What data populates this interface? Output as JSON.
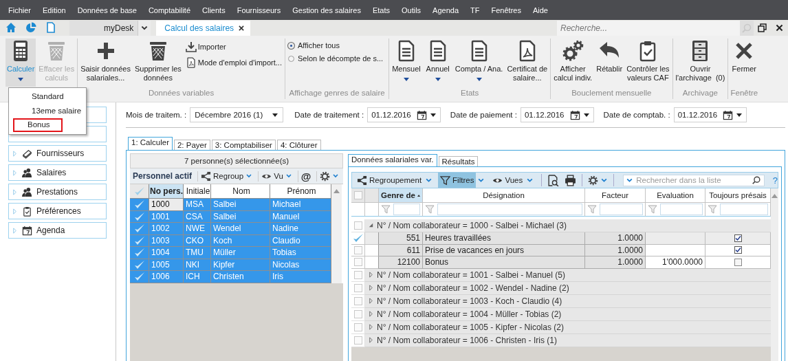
{
  "menu_bar": [
    "Fichier",
    "Edition",
    "Données de base",
    "Comptabilité",
    "Clients",
    "Fournisseurs",
    "Gestion des salaires",
    "Etats",
    "Outils",
    "Agenda",
    "TF",
    "Fenêtres",
    "Aide"
  ],
  "doc_tabs": [
    {
      "label": "myDesk",
      "kind": "dropdown",
      "selected": false
    },
    {
      "label": "Calcul des salaires",
      "kind": "closable",
      "selected": true
    }
  ],
  "search": {
    "placeholder": "Recherche..."
  },
  "ribbon": {
    "groups": [
      {
        "buttons": [
          {
            "label": "Calculer",
            "selected": true,
            "disabled": false,
            "dropdown": true
          },
          {
            "label": "Effacer les\ncalculs",
            "selected": false,
            "disabled": true,
            "dropdown": false
          }
        ]
      },
      {
        "label": "Données variables",
        "buttons": [
          {
            "label": "Saisir données\nsalariales...",
            "selected": false,
            "disabled": false
          },
          {
            "label": "Supprimer les\ndonnées",
            "selected": false,
            "disabled": false
          }
        ],
        "links": [
          "Importer",
          "Mode d'emploi d'import..."
        ]
      },
      {
        "label": "Affichage genres de salaire",
        "options": [
          {
            "label": "Afficher tous",
            "selected": true
          },
          {
            "label": "Selon le décompte de s...",
            "selected": false
          }
        ]
      },
      {
        "label": "Etats",
        "buttons": [
          {
            "label": "Mensuel",
            "selected": false,
            "disabled": false,
            "dropdown": true
          },
          {
            "label": "Annuel",
            "selected": false,
            "disabled": false,
            "dropdown": true
          },
          {
            "label": "Compta / Ana.",
            "selected": false,
            "disabled": false,
            "dropdown": true
          },
          {
            "label": "Certificat de\nsalaire...",
            "selected": false,
            "disabled": false
          }
        ]
      },
      {
        "label": "Bouclement mensuelle",
        "buttons": [
          {
            "label": "Afficher\ncalcul indiv.",
            "selected": false,
            "disabled": false
          },
          {
            "label": "Rétablir",
            "selected": false,
            "disabled": false,
            "dropdown": false
          },
          {
            "label": "Contrôler les\nvaleurs CAF",
            "selected": false,
            "disabled": false
          }
        ]
      },
      {
        "label": "Archivage",
        "buttons": [
          {
            "label": "Ouvrir\nl'archivage  (0)",
            "selected": false,
            "disabled": false
          }
        ]
      },
      {
        "label": "Fenêtre",
        "buttons": [
          {
            "label": "Fermer",
            "selected": false,
            "disabled": false,
            "dropdown": false
          }
        ]
      }
    ]
  },
  "calc_menu": [
    {
      "label": "Standard",
      "selected": false
    },
    {
      "label": "13eme salaire",
      "selected": false
    },
    {
      "label": "Bonus",
      "selected": true
    }
  ],
  "sidebar": {
    "items": [
      {
        "label": "Fournisseurs"
      },
      {
        "label": "Salaires"
      },
      {
        "label": "Prestations"
      },
      {
        "label": "Préférences"
      },
      {
        "label": "Agenda"
      }
    ]
  },
  "period_fields": [
    {
      "kind": "select",
      "label": "Mois de traitem. :",
      "value": "Décembre 2016 (1)"
    },
    {
      "kind": "date",
      "label": "Date de traitement :",
      "value": "01.12.2016"
    },
    {
      "kind": "date",
      "label": "Date de paiement :",
      "value": "01.12.2016"
    },
    {
      "kind": "date",
      "label": "Date de comptab. :",
      "value": "01.12.2016"
    }
  ],
  "process_tabs": [
    {
      "label": "1: Calculer",
      "selected": true
    },
    {
      "label": "2: Payer",
      "selected": false
    },
    {
      "label": "3: Comptabiliser",
      "selected": false
    },
    {
      "label": "4: Clôturer",
      "selected": false
    }
  ],
  "personnel": {
    "summary": "7 personne(s) sélectionnée(s)",
    "title": "Personnel actif",
    "tools": [
      {
        "kind": "group",
        "label": "Regroup"
      },
      {
        "kind": "view",
        "label": "Vu"
      },
      {
        "kind": "mail",
        "label": "@"
      },
      {
        "kind": "settings"
      }
    ],
    "columns": [
      {
        "label": "No pers.",
        "sorted": true
      },
      {
        "label": "Initiale",
        "sorted": false
      },
      {
        "label": "Nom",
        "sorted": false
      },
      {
        "label": "Prénom",
        "sorted": false
      }
    ],
    "rows": [
      {
        "cells": [
          "1000",
          "MSA",
          "Salbei",
          "Michael"
        ],
        "selected": true,
        "focused": true
      },
      {
        "cells": [
          "1001",
          "CSA",
          "Salbei",
          "Manuel"
        ],
        "selected": true,
        "focused": false
      },
      {
        "cells": [
          "1002",
          "NWE",
          "Wendel",
          "Nadine"
        ],
        "selected": true,
        "focused": false
      },
      {
        "cells": [
          "1003",
          "CKO",
          "Koch",
          "Claudio"
        ],
        "selected": true,
        "focused": false
      },
      {
        "cells": [
          "1004",
          "TMU",
          "Müller",
          "Tobias"
        ],
        "selected": true,
        "focused": false
      },
      {
        "cells": [
          "1005",
          "NKI",
          "Kipfer",
          "Nicolas"
        ],
        "selected": true,
        "focused": false
      },
      {
        "cells": [
          "1006",
          "ICH",
          "Christen",
          "Iris"
        ],
        "selected": true,
        "focused": false
      }
    ]
  },
  "salary_data": {
    "tabs": [
      {
        "label": "Données salariales var.",
        "selected": true
      },
      {
        "label": "Résultats",
        "selected": false
      }
    ],
    "tools": [
      {
        "kind": "group",
        "label": "Regroupement",
        "active": false
      },
      {
        "kind": "filter",
        "label": "Filtres",
        "active": true
      },
      {
        "kind": "view",
        "label": "Vues",
        "active": false
      }
    ],
    "search": {
      "placeholder": "Rechercher dans la liste"
    },
    "help": "?",
    "select_all_checked": false,
    "columns": [
      {
        "label": "Genre de",
        "sorted": true
      },
      {
        "label": "Désignation",
        "sorted": false
      },
      {
        "label": "Facteur",
        "sorted": false
      },
      {
        "label": "Evaluation",
        "sorted": false
      },
      {
        "label": "Toujours présais",
        "sorted": false
      }
    ],
    "groups": [
      {
        "label": "N° / Nom collaborateur = 1000 - Salbei - Michael (3)",
        "expanded": true,
        "checked": false,
        "children": [
          {
            "code": "551",
            "designation": "Heures travaillées",
            "factor": "1.0000",
            "always_entered": true,
            "selected": true
          },
          {
            "code": "611",
            "designation": "Prise de vacances en jours",
            "factor": "1.0000",
            "always_entered": true,
            "selected": false
          },
          {
            "code": "12100",
            "designation": "Bonus",
            "factor": "1.0000",
            "evaluation": "1'000.0000",
            "always_entered": false,
            "selected": false
          }
        ]
      },
      {
        "label": "N° / Nom collaborateur = 1001 - Salbei - Manuel (5)",
        "expanded": false,
        "checked": false
      },
      {
        "label": "N° / Nom collaborateur = 1002 - Wendel - Nadine (2)",
        "expanded": false,
        "checked": false
      },
      {
        "label": "N° / Nom collaborateur = 1003 - Koch - Claudio (4)",
        "expanded": false,
        "checked": false
      },
      {
        "label": "N° / Nom collaborateur = 1004 - Müller - Tobias (2)",
        "expanded": false,
        "checked": false
      },
      {
        "label": "N° / Nom collaborateur = 1005 - Kipfer - Nicolas (2)",
        "expanded": false,
        "checked": false
      },
      {
        "label": "N° / Nom collaborateur = 1006 - Christen - Iris (1)",
        "expanded": false,
        "checked": false
      }
    ]
  }
}
